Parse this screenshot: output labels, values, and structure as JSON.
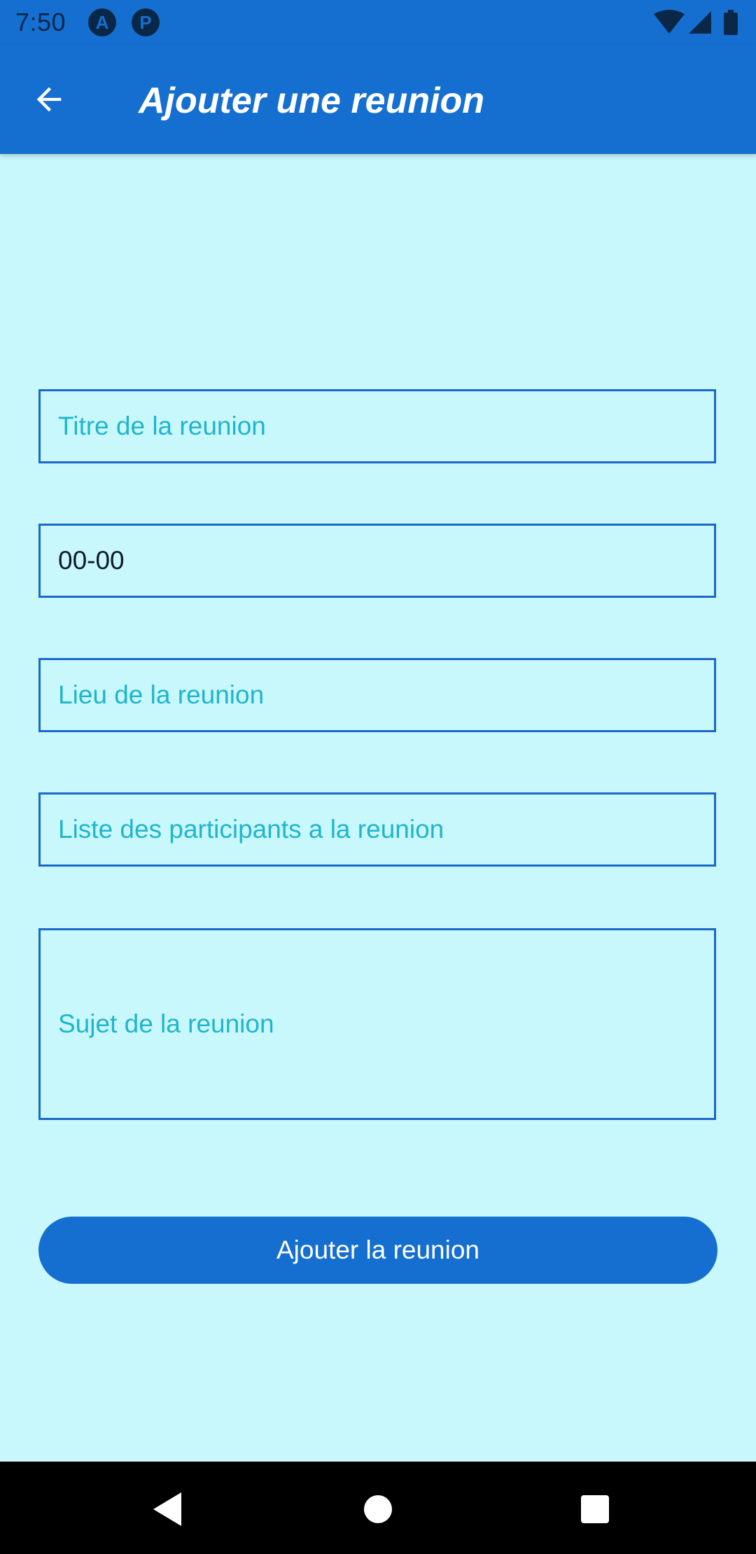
{
  "status_bar": {
    "time": "7:50",
    "app_icon_1": "A",
    "app_icon_2": "P",
    "icons": [
      "wifi-icon",
      "signal-icon",
      "battery-icon"
    ]
  },
  "app_bar": {
    "title": "Ajouter une reunion",
    "back_icon": "arrow-left-icon"
  },
  "form": {
    "title_placeholder": "Titre de la reunion",
    "time_value": "00-00",
    "location_placeholder": "Lieu de la reunion",
    "participants_placeholder": "Liste des participants a la reunion",
    "subject_placeholder": "Sujet de la reunion",
    "submit_label": "Ajouter la reunion"
  },
  "nav_bar": {
    "icons": [
      "back-triangle-icon",
      "home-circle-icon",
      "recents-square-icon"
    ]
  },
  "colors": {
    "primary": "#156FD0",
    "background": "#C8F8FB",
    "placeholder": "#20B5CC",
    "field_border": "#1A68C9"
  }
}
